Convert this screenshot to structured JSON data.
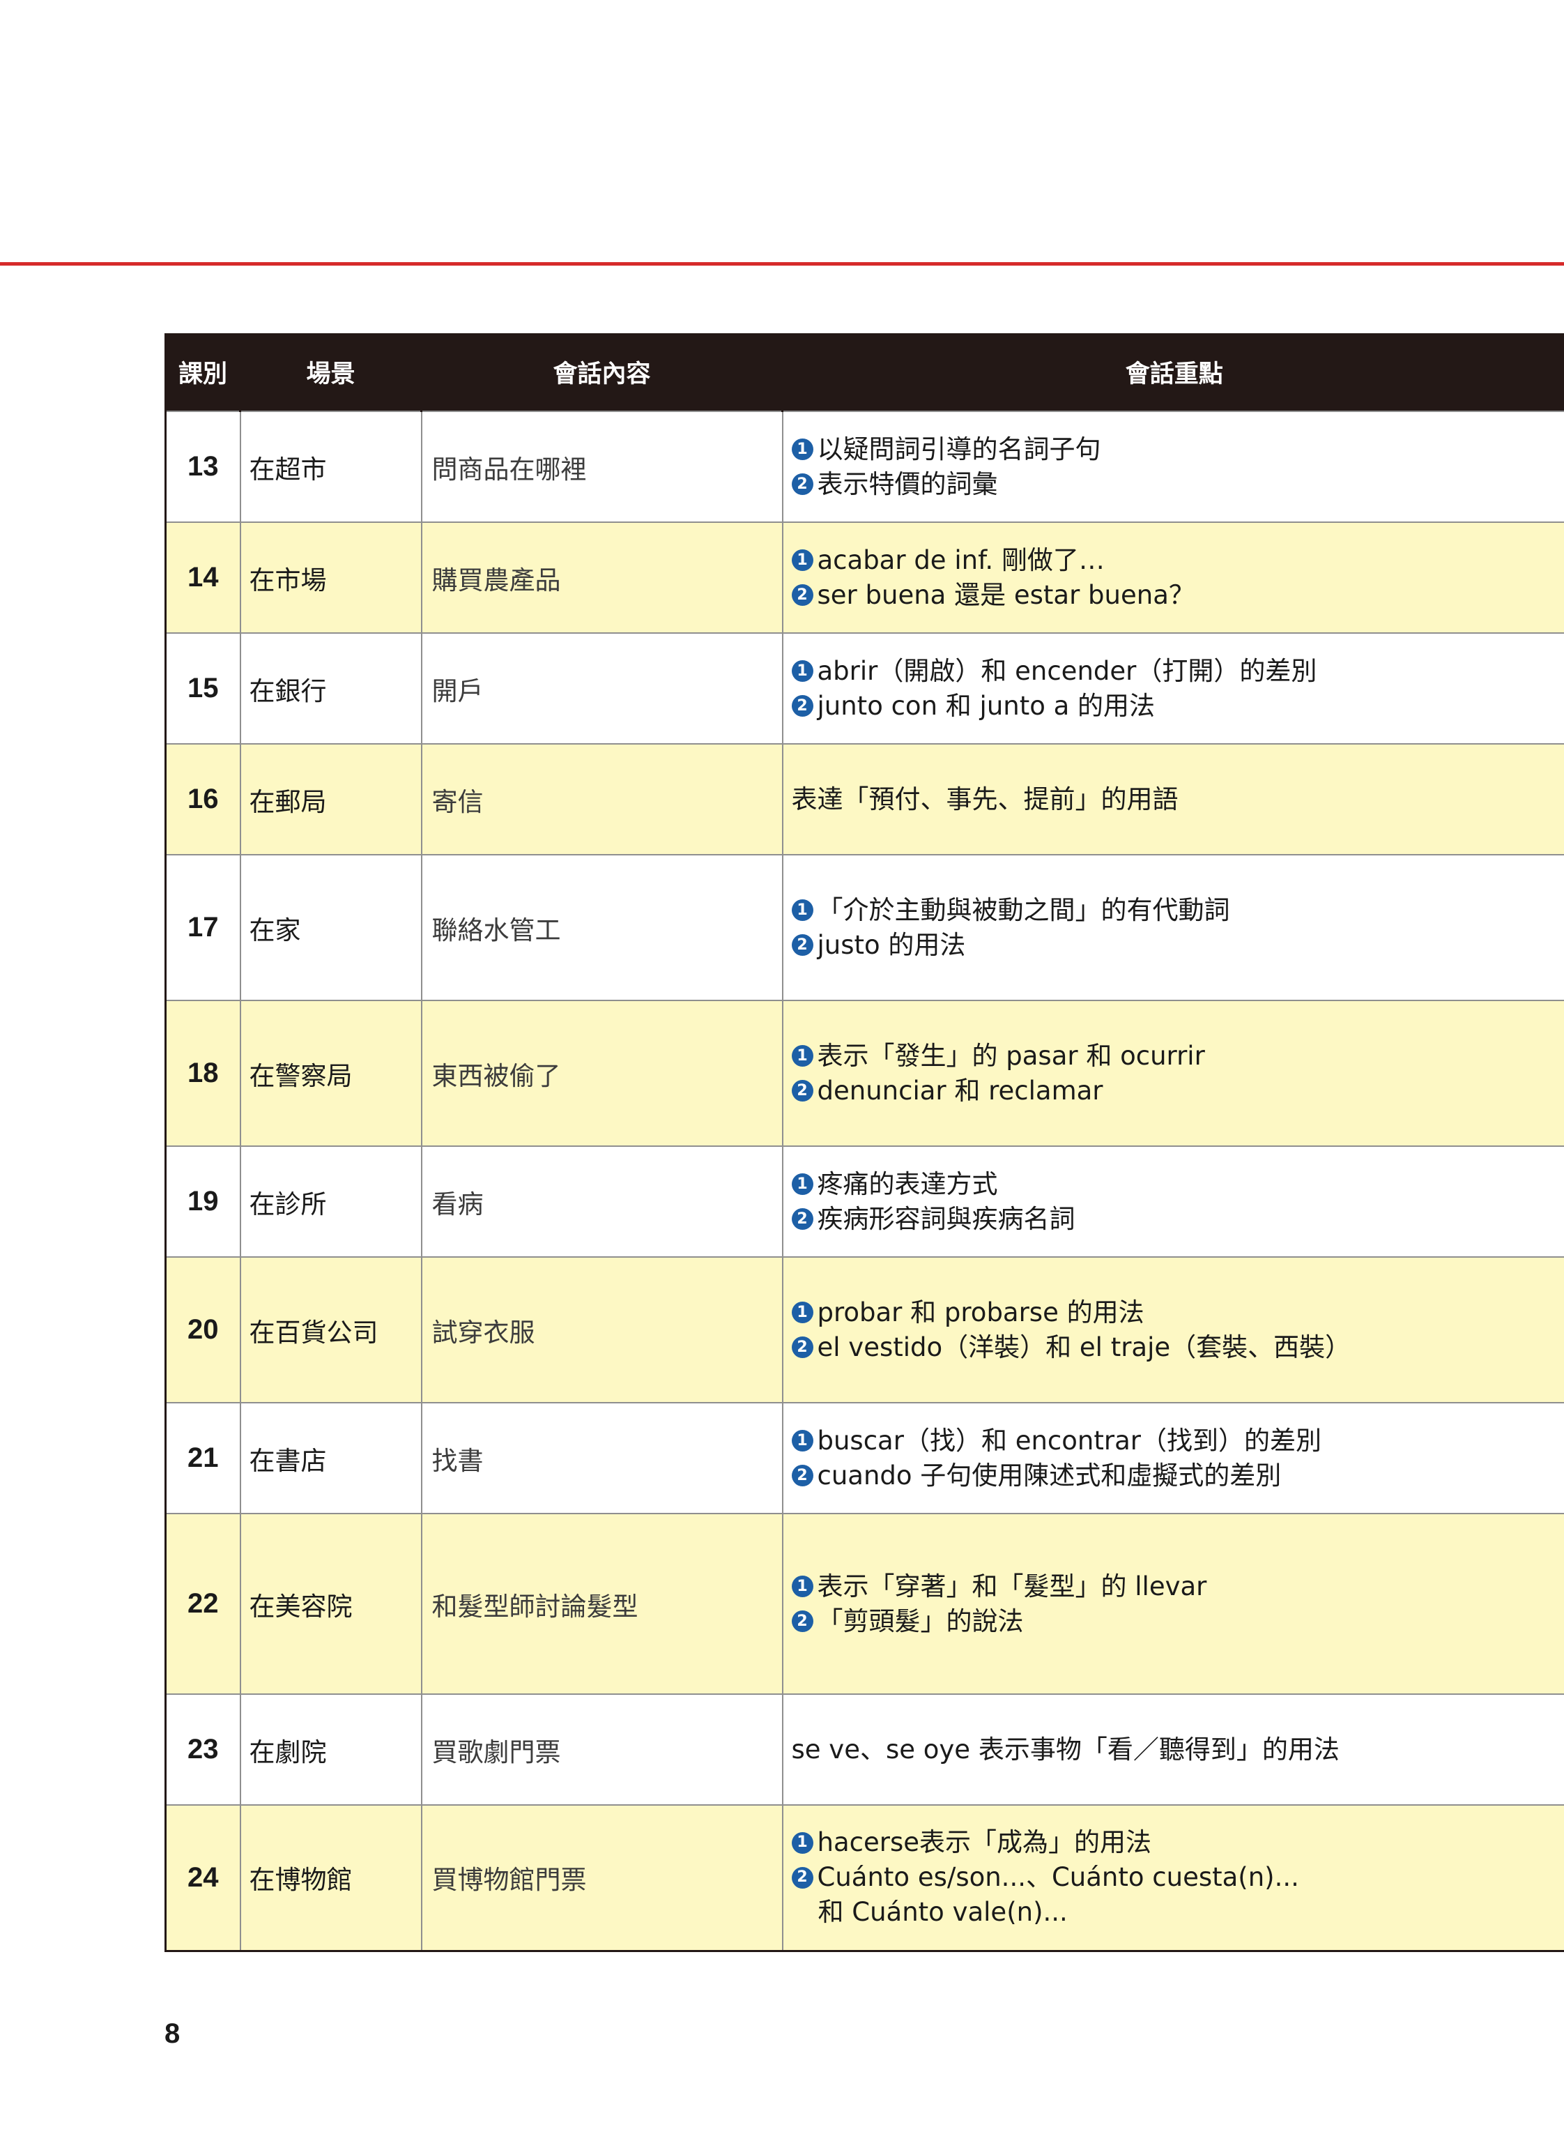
{
  "header": {
    "col_lesson": "課別",
    "col_scene": "場景",
    "col_content": "會話內容",
    "col_points": "會話重點"
  },
  "rows": [
    {
      "num": "13",
      "scene": "在超市",
      "content": "問商品在哪裡",
      "points": [
        {
          "marker": "1",
          "text": "以疑問詞引導的名詞子句"
        },
        {
          "marker": "2",
          "text": "表示特價的詞彙"
        }
      ]
    },
    {
      "num": "14",
      "scene": "在市場",
      "content": "購買農產品",
      "points": [
        {
          "marker": "1",
          "text": "acabar de inf. 剛做了…"
        },
        {
          "marker": "2",
          "text": "ser buena 還是 estar buena？"
        }
      ]
    },
    {
      "num": "15",
      "scene": "在銀行",
      "content": "開戶",
      "points": [
        {
          "marker": "1",
          "text": "abrir（開啟）和 encender（打開）的差別"
        },
        {
          "marker": "2",
          "text": "junto con 和 junto a 的用法"
        }
      ]
    },
    {
      "num": "16",
      "scene": "在郵局",
      "content": "寄信",
      "points": [
        {
          "marker": "",
          "text": "表達「預付、事先、提前」的用語"
        }
      ]
    },
    {
      "num": "17",
      "scene": "在家",
      "content": "聯絡水管工",
      "points": [
        {
          "marker": "1",
          "text": "「介於主動與被動之間」的有代動詞"
        },
        {
          "marker": "2",
          "text": "justo 的用法"
        }
      ]
    },
    {
      "num": "18",
      "scene": "在警察局",
      "content": "東西被偷了",
      "points": [
        {
          "marker": "1",
          "text": "表示「發生」的 pasar 和 ocurrir"
        },
        {
          "marker": "2",
          "text": "denunciar 和 reclamar"
        }
      ]
    },
    {
      "num": "19",
      "scene": "在診所",
      "content": "看病",
      "points": [
        {
          "marker": "1",
          "text": "疼痛的表達方式"
        },
        {
          "marker": "2",
          "text": "疾病形容詞與疾病名詞"
        }
      ]
    },
    {
      "num": "20",
      "scene": "在百貨公司",
      "content": "試穿衣服",
      "points": [
        {
          "marker": "1",
          "text": "probar 和 probarse 的用法"
        },
        {
          "marker": "2",
          "text": "el vestido（洋裝）和 el traje（套裝、西裝）"
        }
      ]
    },
    {
      "num": "21",
      "scene": "在書店",
      "content": "找書",
      "points": [
        {
          "marker": "1",
          "text": "buscar（找）和 encontrar（找到）的差別"
        },
        {
          "marker": "2",
          "text": "cuando 子句使用陳述式和虛擬式的差別"
        }
      ]
    },
    {
      "num": "22",
      "scene": "在美容院",
      "content": "和髮型師討論髮型",
      "points": [
        {
          "marker": "1",
          "text": "表示「穿著」和「髮型」的 llevar"
        },
        {
          "marker": "2",
          "text": "「剪頭髮」的說法"
        }
      ]
    },
    {
      "num": "23",
      "scene": "在劇院",
      "content": "買歌劇門票",
      "points": [
        {
          "marker": "",
          "text": "se ve、se oye 表示事物「看／聽得到」的用法"
        }
      ]
    },
    {
      "num": "24",
      "scene": "在博物館",
      "content": "買博物館門票",
      "points": [
        {
          "marker": "1",
          "text": "hacerse表示「成為」的用法"
        },
        {
          "marker": "2",
          "text": "Cuánto es/son...、Cuánto cuesta(n)..."
        },
        {
          "marker": "",
          "text": "和 Cuánto vale(n)...",
          "indent": true
        }
      ]
    }
  ],
  "page_number": "8",
  "colors": {
    "accent_rule": "#d62a2a",
    "header_bg": "#231816",
    "row_alt_bg": "#fdf8c4",
    "marker_bg": "#1d5fa6"
  }
}
